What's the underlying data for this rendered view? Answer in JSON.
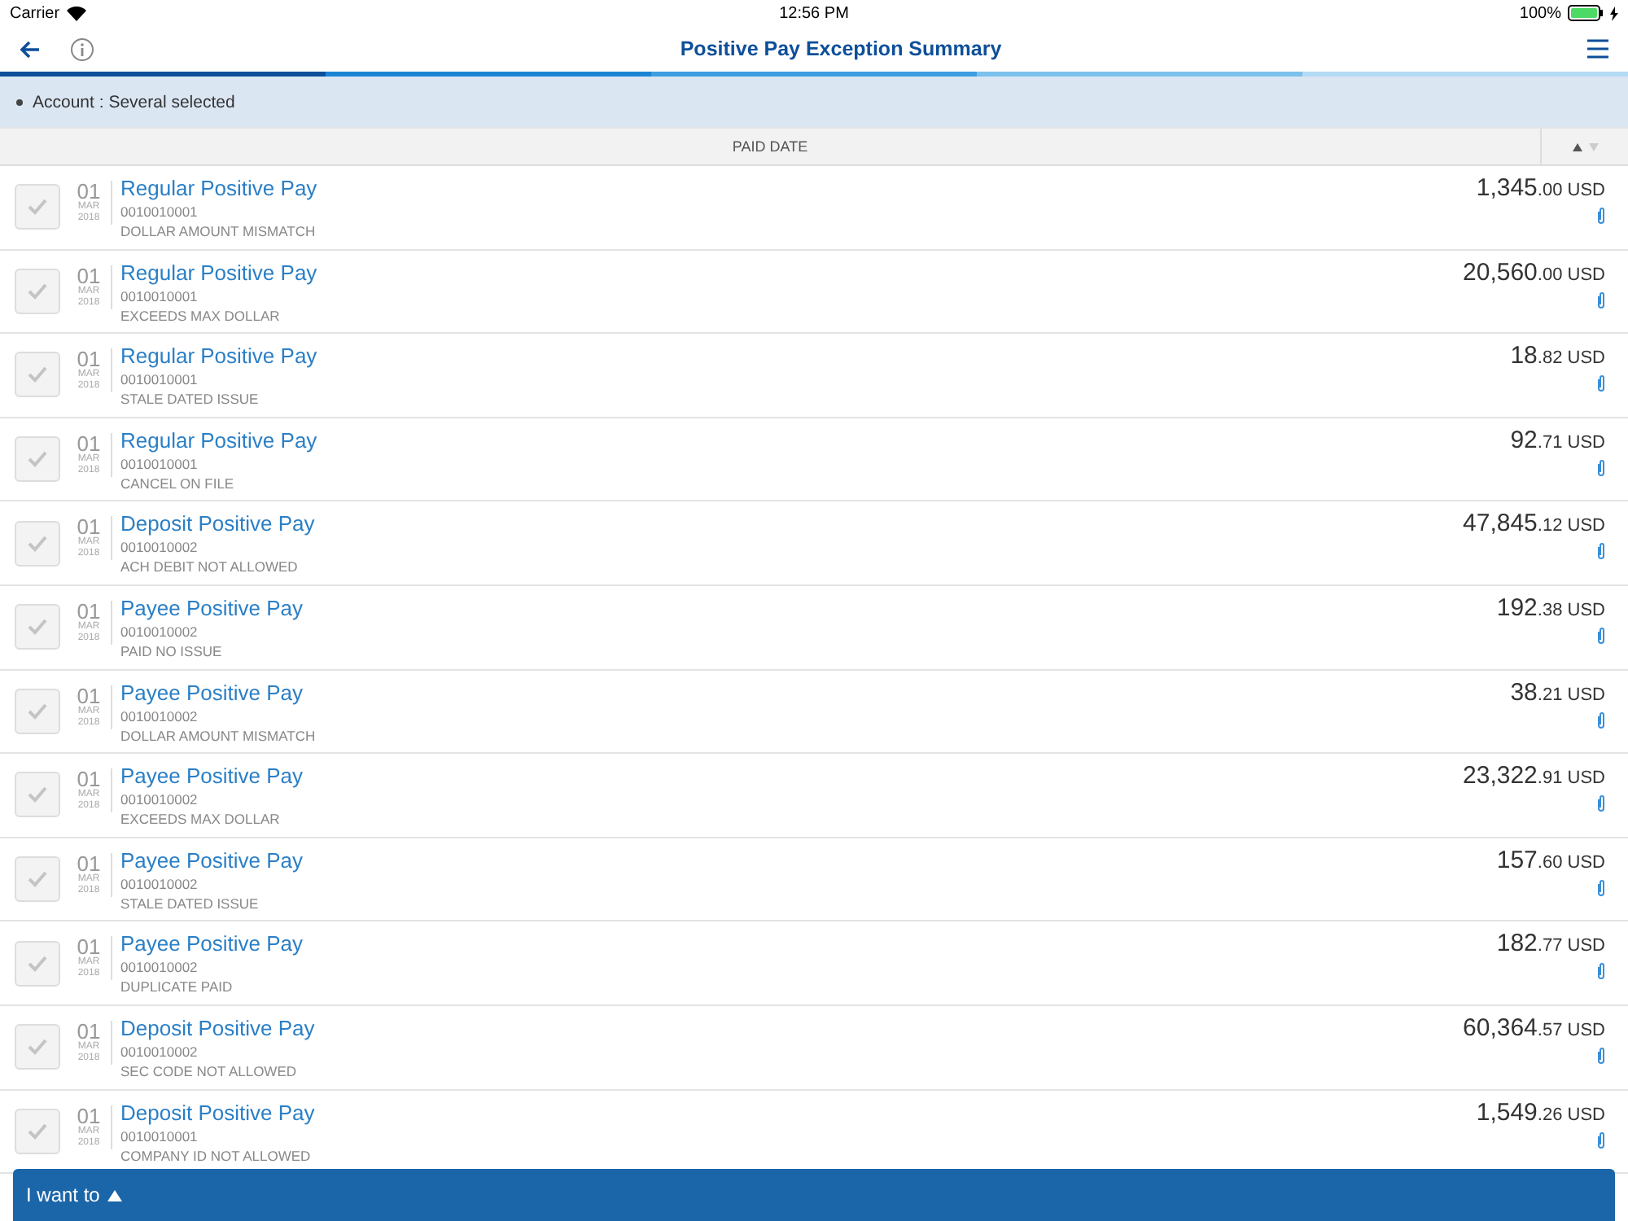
{
  "status_bar": {
    "carrier": "Carrier",
    "time": "12:56 PM",
    "battery": "100%"
  },
  "nav": {
    "title": "Positive Pay Exception Summary"
  },
  "filter": {
    "label": "Account : Several selected"
  },
  "table": {
    "column": "PAID DATE",
    "rows": [
      {
        "day": "01",
        "month": "MAR",
        "year": "2018",
        "title": "Regular Positive Pay",
        "account": "0010010001",
        "reason": "DOLLAR AMOUNT MISMATCH",
        "whole": "1,345",
        "cents": ".00",
        "currency": "USD",
        "checked": false
      },
      {
        "day": "01",
        "month": "MAR",
        "year": "2018",
        "title": "Regular Positive Pay",
        "account": "0010010001",
        "reason": "EXCEEDS MAX DOLLAR",
        "whole": "20,560",
        "cents": ".00",
        "currency": "USD",
        "checked": false
      },
      {
        "day": "01",
        "month": "MAR",
        "year": "2018",
        "title": "Regular Positive Pay",
        "account": "0010010001",
        "reason": "STALE DATED ISSUE",
        "whole": "18",
        "cents": ".82",
        "currency": "USD",
        "checked": false
      },
      {
        "day": "01",
        "month": "MAR",
        "year": "2018",
        "title": "Regular Positive Pay",
        "account": "0010010001",
        "reason": "CANCEL ON FILE",
        "whole": "92",
        "cents": ".71",
        "currency": "USD",
        "checked": false
      },
      {
        "day": "01",
        "month": "MAR",
        "year": "2018",
        "title": "Deposit Positive Pay",
        "account": "0010010002",
        "reason": "ACH DEBIT NOT ALLOWED",
        "whole": "47,845",
        "cents": ".12",
        "currency": "USD",
        "checked": false
      },
      {
        "day": "01",
        "month": "MAR",
        "year": "2018",
        "title": "Payee Positive Pay",
        "account": "0010010002",
        "reason": "PAID NO ISSUE",
        "whole": "192",
        "cents": ".38",
        "currency": "USD",
        "checked": false
      },
      {
        "day": "01",
        "month": "MAR",
        "year": "2018",
        "title": "Payee Positive Pay",
        "account": "0010010002",
        "reason": "DOLLAR AMOUNT MISMATCH",
        "whole": "38",
        "cents": ".21",
        "currency": "USD",
        "checked": false
      },
      {
        "day": "01",
        "month": "MAR",
        "year": "2018",
        "title": "Payee Positive Pay",
        "account": "0010010002",
        "reason": "EXCEEDS MAX DOLLAR",
        "whole": "23,322",
        "cents": ".91",
        "currency": "USD",
        "checked": false
      },
      {
        "day": "01",
        "month": "MAR",
        "year": "2018",
        "title": "Payee Positive Pay",
        "account": "0010010002",
        "reason": "STALE DATED ISSUE",
        "whole": "157",
        "cents": ".60",
        "currency": "USD",
        "checked": false
      },
      {
        "day": "01",
        "month": "MAR",
        "year": "2018",
        "title": "Payee Positive Pay",
        "account": "0010010002",
        "reason": "DUPLICATE PAID",
        "whole": "182",
        "cents": ".77",
        "currency": "USD",
        "checked": false
      },
      {
        "day": "01",
        "month": "MAR",
        "year": "2018",
        "title": "Deposit Positive Pay",
        "account": "0010010002",
        "reason": "SEC CODE NOT ALLOWED",
        "whole": "60,364",
        "cents": ".57",
        "currency": "USD",
        "checked": false
      },
      {
        "day": "01",
        "month": "MAR",
        "year": "2018",
        "title": "Deposit Positive Pay",
        "account": "0010010001",
        "reason": "COMPANY ID NOT ALLOWED",
        "whole": "1,549",
        "cents": ".26",
        "currency": "USD",
        "checked": false
      }
    ]
  },
  "action_bar": {
    "label": "I want to"
  }
}
